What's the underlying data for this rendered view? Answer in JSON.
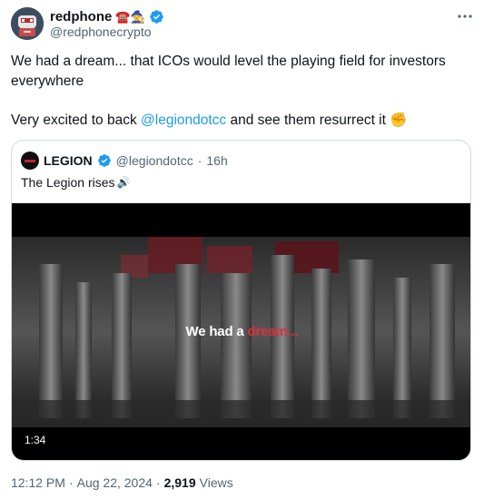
{
  "author": {
    "display_name": "redphone",
    "emojis": "☎️🧙",
    "handle": "@redphonecrypto"
  },
  "tweet": {
    "line1": "We had a dream... that ICOs would level the playing field for investors everywhere",
    "line2_before": "Very excited to back ",
    "line2_mention": "@legiondotcc",
    "line2_after": " and see them resurrect it ",
    "line2_emoji": "✊"
  },
  "quoted": {
    "display_name": "LEGION",
    "handle": "@legiondotcc",
    "separator": "·",
    "time": "16h",
    "text": "The Legion rises",
    "speaker_emoji": "🔊",
    "video": {
      "caption_white": "We had a ",
      "caption_red": "dream...",
      "duration": "1:34"
    }
  },
  "footer": {
    "time": "12:12 PM",
    "dot1": "·",
    "date": "Aug 22, 2024",
    "dot2": "·",
    "views_count": "2,919",
    "views_label": "Views"
  },
  "colors": {
    "link": "#1d9bf0",
    "verified": "#1d9bf0",
    "secondary_text": "#536471",
    "border": "#cfd9de",
    "video_red": "#e0303a"
  },
  "icons": [
    "avatar-image",
    "verified-badge-icon",
    "more-icon",
    "legion-logo"
  ]
}
